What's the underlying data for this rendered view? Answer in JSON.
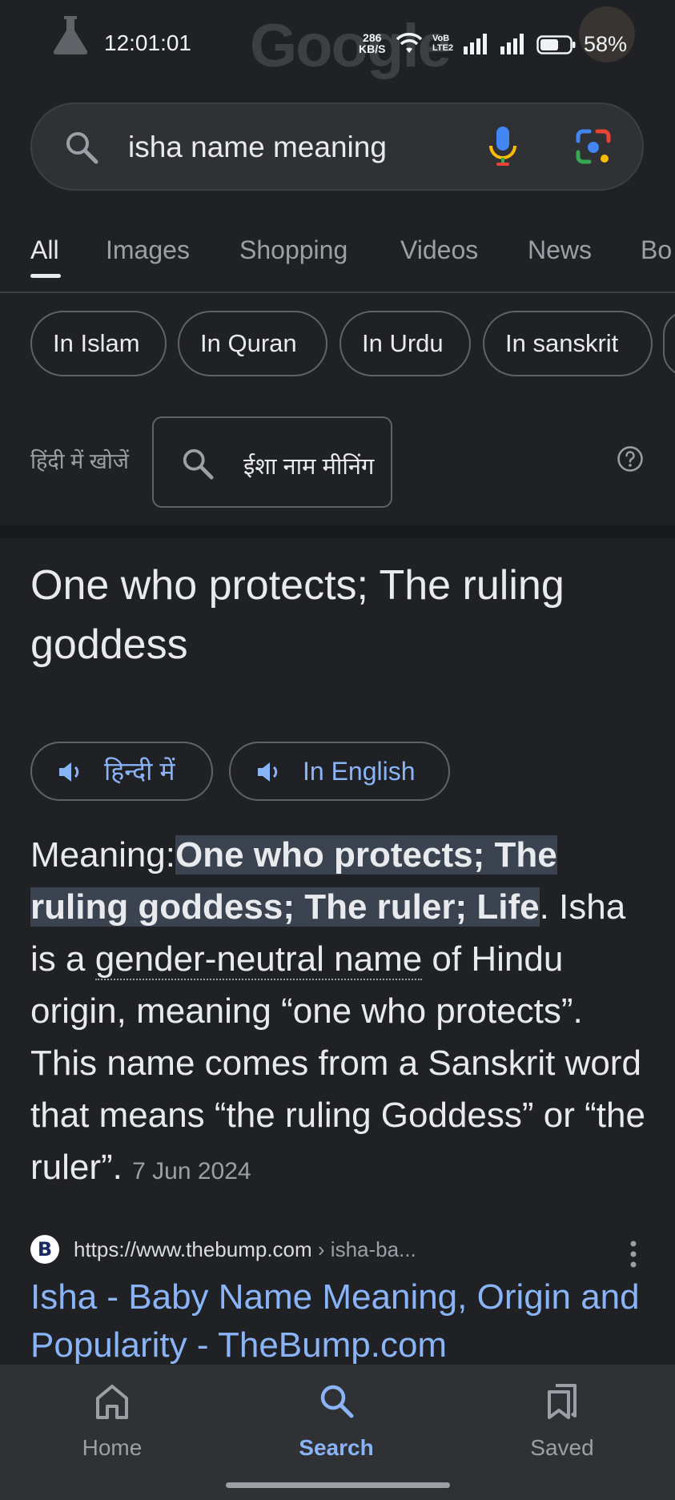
{
  "status_bar": {
    "time": "12:01:01",
    "google_watermark": "Google",
    "net_speed": "286",
    "net_unit": "KB/S",
    "volte_top": "VoB",
    "volte_bottom": "LTE2",
    "battery": "58%",
    "icons": [
      "flask-icon",
      "wifi-icon",
      "signal-icon",
      "battery-icon"
    ]
  },
  "search": {
    "query": "isha name meaning",
    "icons": [
      "search-icon",
      "mic-icon",
      "lens-icon"
    ]
  },
  "tabs": [
    {
      "label": "All",
      "active": true
    },
    {
      "label": "Images"
    },
    {
      "label": "Shopping"
    },
    {
      "label": "Videos"
    },
    {
      "label": "News"
    },
    {
      "label": "Bo"
    }
  ],
  "chips": [
    "In Islam",
    "In Quran",
    "In Urdu",
    "In sanskrit"
  ],
  "hindi_search": {
    "label": "हिंदी में खोजें",
    "query": "ईशा नाम मीनिंग"
  },
  "answer": {
    "title": "One who protects; The ruling goddess",
    "audio_buttons": [
      {
        "label": "हिन्दी में"
      },
      {
        "label": "In English"
      }
    ],
    "meaning_prefix": "Meaning:",
    "meaning_highlight": "One who protects; The ruling goddess; The ruler; Life",
    "meaning_part1": ". Isha is a ",
    "meaning_link": "gender-neutral name",
    "meaning_part2": " of Hindu origin, meaning “one who protects”. This name comes from a Sanskrit word that means “the ruling Goddess” or “the ruler”.",
    "date": "7 Jun 2024"
  },
  "source": {
    "favicon_letter": "B",
    "url": "https://www.thebump.com",
    "crumb": " › isha-ba...",
    "title": "Isha - Baby Name Meaning, Origin and Popularity - TheBump.com"
  },
  "bottom_nav": [
    {
      "label": "Home",
      "icon": "home-icon"
    },
    {
      "label": "Search",
      "icon": "search-icon",
      "active": true
    },
    {
      "label": "Saved",
      "icon": "saved-icon"
    }
  ],
  "colors": {
    "background": "#202124",
    "link": "#8ab4f8",
    "text": "#e8eaed",
    "muted": "#9aa0a6"
  }
}
